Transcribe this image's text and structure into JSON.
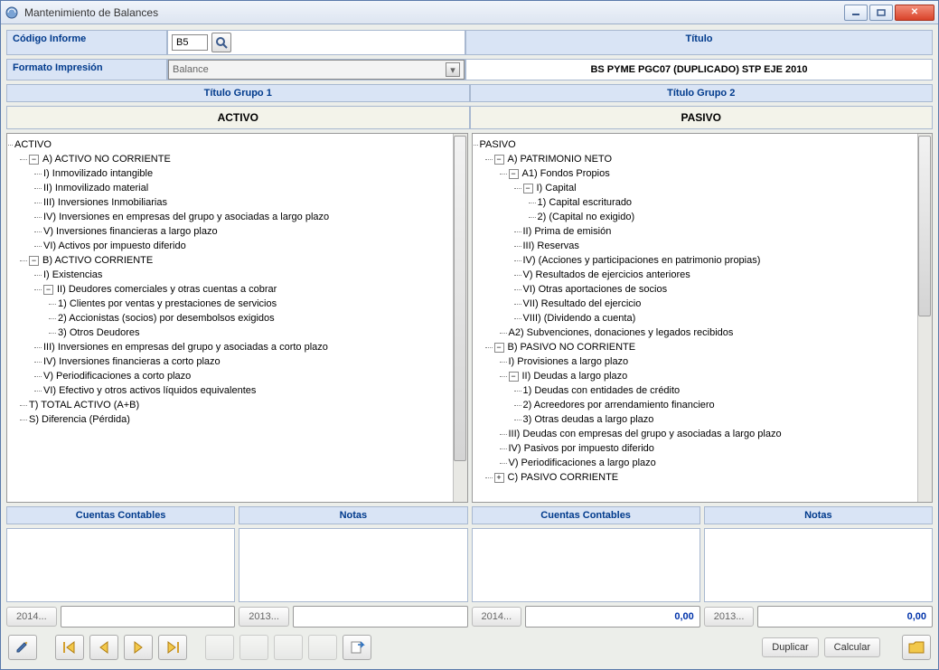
{
  "titlebar": {
    "title": "Mantenimiento de Balances"
  },
  "form": {
    "codigo_label": "Código Informe",
    "codigo_value": "B5",
    "formato_label": "Formato Impresión",
    "formato_value": "Balance",
    "titulo_header": "Título",
    "titulo_value": "BS PYME PGC07 (DUPLICADO) STP EJE 2010"
  },
  "groups": {
    "g1_header": "Título Grupo 1",
    "g1_name": "ACTIVO",
    "g2_header": "Título Grupo 2",
    "g2_name": "PASIVO"
  },
  "activo": {
    "root": "ACTIVO",
    "a": "A) ACTIVO NO CORRIENTE",
    "a1": "I) Inmovilizado intangible",
    "a2": "II) Inmovilizado material",
    "a3": "III) Inversiones Inmobiliarias",
    "a4": "IV) Inversiones en empresas del grupo y asociadas a largo plazo",
    "a5": "V) Inversiones financieras a largo plazo",
    "a6": "VI) Activos por impuesto diferido",
    "b": "B) ACTIVO CORRIENTE",
    "b1": "I) Existencias",
    "b2": "II) Deudores comerciales y otras cuentas a cobrar",
    "b21": "1) Clientes por ventas y prestaciones de servicios",
    "b22": "2) Accionistas (socios) por desembolsos exigidos",
    "b23": "3) Otros Deudores",
    "b3": "III) Inversiones en empresas del grupo y asociadas a corto plazo",
    "b4": "IV) Inversiones financieras a corto plazo",
    "b5": "V) Periodificaciones a corto plazo",
    "b6": "VI) Efectivo y otros activos líquidos equivalentes",
    "t": "T) TOTAL ACTIVO (A+B)",
    "s": "S) Diferencia (Pérdida)"
  },
  "pasivo": {
    "root": "PASIVO",
    "a": "A) PATRIMONIO NETO",
    "a1": "A1) Fondos Propios",
    "a1i": "I) Capital",
    "a1i1": "1) Capital escriturado",
    "a1i2": "2) (Capital no exigido)",
    "a1ii": "II) Prima de emisión",
    "a1iii": "III) Reservas",
    "a1iv": "IV) (Acciones y participaciones en patrimonio propias)",
    "a1v": "V) Resultados de ejercicios anteriores",
    "a1vi": "VI) Otras aportaciones de socios",
    "a1vii": "VII) Resultado del ejercicio",
    "a1viii": "VIII) (Dividendo a cuenta)",
    "a2": "A2) Subvenciones, donaciones y legados recibidos",
    "b": "B) PASIVO NO CORRIENTE",
    "b1": "I) Provisiones a largo plazo",
    "b2": "II) Deudas a largo plazo",
    "b21": "1) Deudas con entidades de crédito",
    "b22": "2) Acreedores por arrendamiento financiero",
    "b23": "3) Otras deudas a largo plazo",
    "b3": "III) Deudas con empresas del grupo y asociadas a largo plazo",
    "b4": "IV) Pasivos por impuesto diferido",
    "b5": "V) Periodificaciones a largo plazo",
    "c": "C) PASIVO CORRIENTE"
  },
  "panels": {
    "cuentas": "Cuentas Contables",
    "notas": "Notas"
  },
  "years": {
    "y1": "2014...",
    "y2": "2013...",
    "v3": "0,00",
    "v4": "0,00"
  },
  "buttons": {
    "duplicar": "Duplicar",
    "calcular": "Calcular"
  }
}
